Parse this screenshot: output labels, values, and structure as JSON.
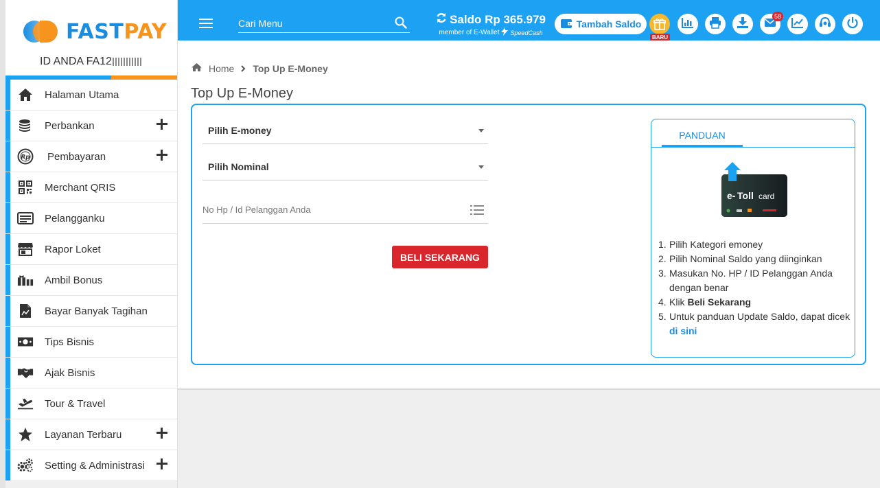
{
  "brand": {
    "name_part1": "FAST",
    "name_part2": "PAY",
    "user_id_prefix": "ID ANDA FA12"
  },
  "menu": [
    {
      "label": "Halaman Utama",
      "icon": "home-icon",
      "expandable": false
    },
    {
      "label": "Perbankan",
      "icon": "coins-icon",
      "expandable": true
    },
    {
      "label": "Pembayaran",
      "icon": "rp-coin-icon",
      "expandable": true
    },
    {
      "label": "Merchant QRIS",
      "icon": "qr-code-icon",
      "expandable": false
    },
    {
      "label": "Pelangganku",
      "icon": "id-card-icon",
      "expandable": false
    },
    {
      "label": "Rapor Loket",
      "icon": "store-icon",
      "expandable": false
    },
    {
      "label": "Ambil Bonus",
      "icon": "gift-icon",
      "expandable": false
    },
    {
      "label": "Bayar Banyak Tagihan",
      "icon": "invoice-icon",
      "expandable": false
    },
    {
      "label": "Tips Bisnis",
      "icon": "money-bill-icon",
      "expandable": false
    },
    {
      "label": "Ajak Bisnis",
      "icon": "handshake-icon",
      "expandable": false
    },
    {
      "label": "Tour & Travel",
      "icon": "plane-departure-icon",
      "expandable": false
    },
    {
      "label": "Layanan Terbaru",
      "icon": "star-icon",
      "expandable": true
    },
    {
      "label": "Setting & Administrasi",
      "icon": "gears-icon",
      "expandable": true
    }
  ],
  "topbar": {
    "search_placeholder": "Cari Menu",
    "saldo_label": "Saldo Rp 365.979",
    "member_label": "member of E-Wallet",
    "speedcash_label": "SpeedCash",
    "tambah_saldo": "Tambah Saldo",
    "baru_label": "BARU",
    "message_count": "58"
  },
  "breadcrumb": {
    "home": "Home",
    "current": "Top Up E-Money"
  },
  "page": {
    "title": "Top Up E-Money"
  },
  "form": {
    "emoney_select": "Pilih E-money",
    "nominal_select": "Pilih Nominal",
    "customer_placeholder": "No Hp / Id Pelanggan Anda",
    "buy_button": "BELI SEKARANG"
  },
  "panduan": {
    "tab_label": "PANDUAN",
    "card_brand_1": "e-",
    "card_brand_2": "Toll",
    "card_brand_3": "card",
    "steps": [
      {
        "num": "1.",
        "text": "Pilih Kategori emoney"
      },
      {
        "num": "2.",
        "text": "Pilih Nominal Saldo yang diinginkan"
      },
      {
        "num": "3.",
        "text": "Masukan No. HP / ID Pelanggan Anda dengan benar"
      },
      {
        "num": "4.",
        "text_before": "Klik ",
        "bold": "Beli Sekarang"
      },
      {
        "num": "5.",
        "text_before": "Untuk panduan Update Saldo, dapat dicek ",
        "link": "di sini"
      }
    ]
  },
  "colors": {
    "primary_blue": "#1da1f2",
    "accent_orange": "#f7941d",
    "danger_red": "#d9262c"
  }
}
